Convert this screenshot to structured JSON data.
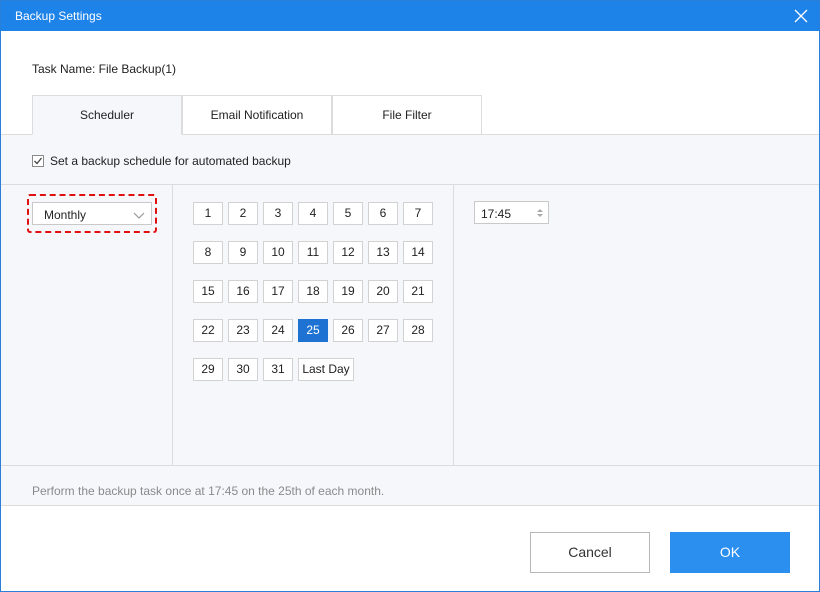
{
  "window": {
    "title": "Backup Settings"
  },
  "task": {
    "name_label": "Task Name: File Backup(1)"
  },
  "tabs": [
    {
      "label": "Scheduler",
      "active": true
    },
    {
      "label": "Email Notification",
      "active": false
    },
    {
      "label": "File Filter",
      "active": false
    }
  ],
  "scheduler": {
    "enable_label": "Set a backup schedule for automated backup",
    "enabled": true,
    "frequency": "Monthly",
    "days": [
      "1",
      "2",
      "3",
      "4",
      "5",
      "6",
      "7",
      "8",
      "9",
      "10",
      "11",
      "12",
      "13",
      "14",
      "15",
      "16",
      "17",
      "18",
      "19",
      "20",
      "21",
      "22",
      "23",
      "24",
      "25",
      "26",
      "27",
      "28",
      "29",
      "30",
      "31"
    ],
    "last_day_label": "Last Day",
    "selected_day": "25",
    "time": "17:45",
    "summary": "Perform the backup task once at 17:45 on the 25th of each month."
  },
  "buttons": {
    "cancel": "Cancel",
    "ok": "OK"
  },
  "colors": {
    "accent": "#1e83e8",
    "selected_day": "#1e73d2",
    "highlight": "#e01010"
  }
}
